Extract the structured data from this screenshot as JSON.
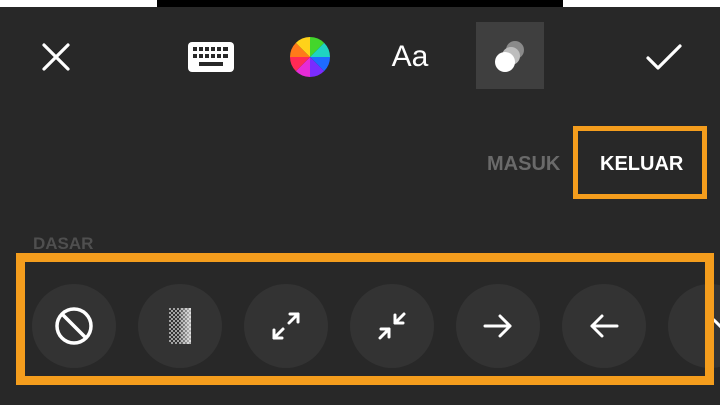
{
  "toolbar": {
    "close_icon": "close-icon",
    "keyboard_icon": "keyboard-icon",
    "color_icon": "color-wheel-icon",
    "font_label": "Aa",
    "animation_icon": "animation-icon",
    "done_icon": "checkmark-icon"
  },
  "tabs": {
    "in_label": "MASUK",
    "out_label": "KELUAR",
    "selected": "KELUAR"
  },
  "section": {
    "label": "DASAR"
  },
  "animations": [
    {
      "icon": "none-icon"
    },
    {
      "icon": "fade-icon"
    },
    {
      "icon": "expand-icon"
    },
    {
      "icon": "shrink-icon"
    },
    {
      "icon": "arrow-right-icon"
    },
    {
      "icon": "arrow-left-icon"
    },
    {
      "icon": "chevron-down-icon"
    }
  ],
  "colors": {
    "background": "#282828",
    "highlight": "#f49d1d",
    "button_circle": "#333333",
    "selected_tool_bg": "#3f3f3f",
    "inactive_tab": "#6a6a6a",
    "active_tab": "#ffffff"
  }
}
